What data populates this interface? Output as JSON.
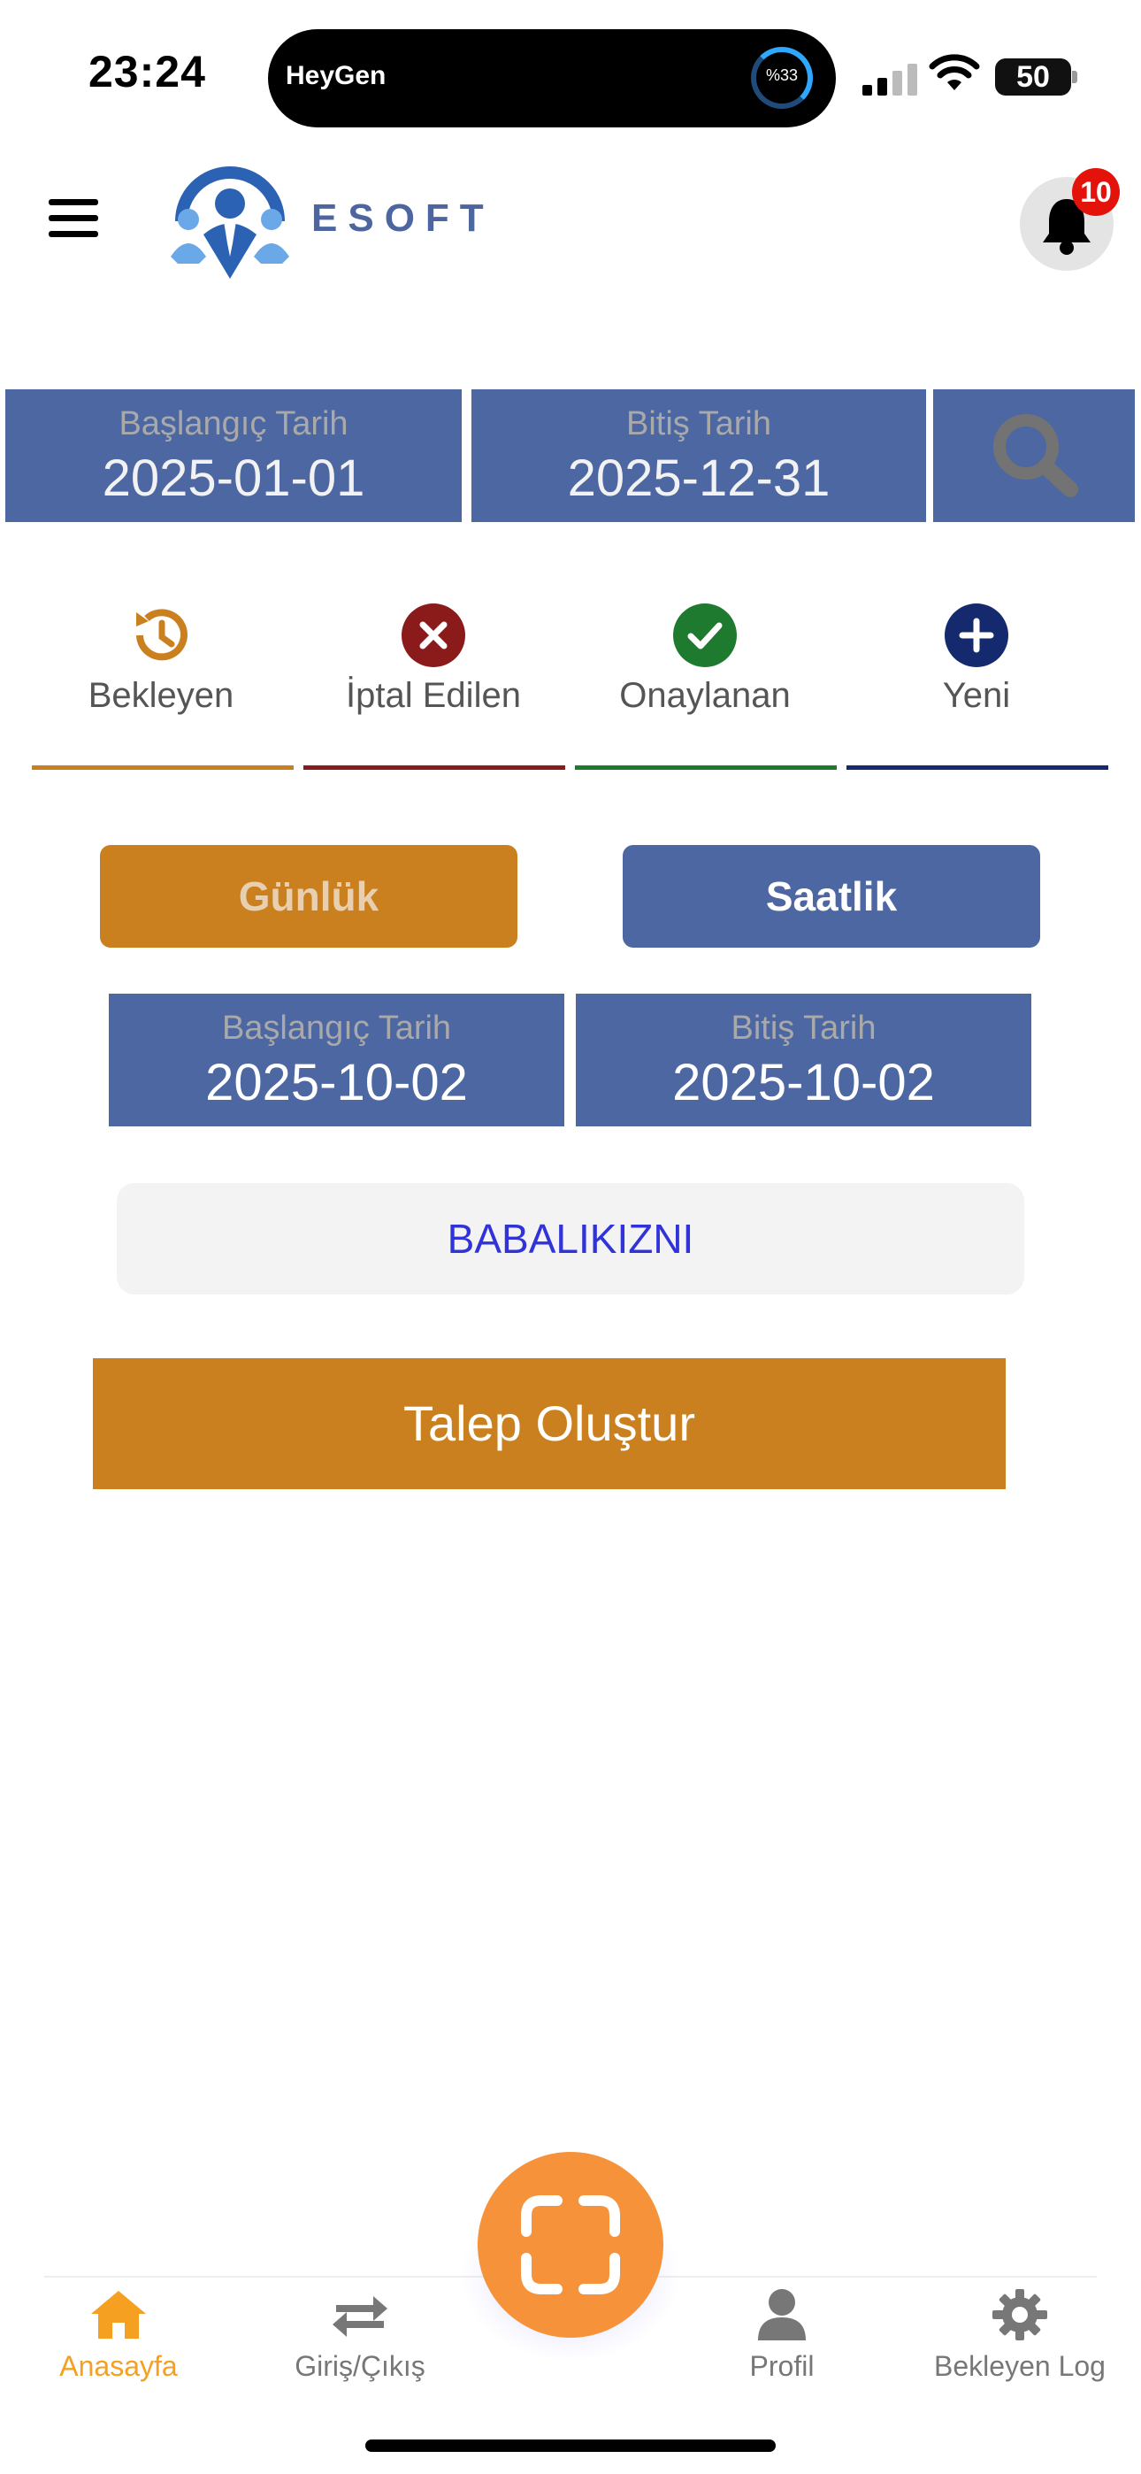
{
  "status_bar": {
    "time": "23:24",
    "island_app": "HeyGen",
    "island_progress": "%33",
    "battery": "50"
  },
  "header": {
    "brand": "ESOFT",
    "notification_count": "10"
  },
  "filter": {
    "start_label": "Başlangıç Tarih",
    "start_value": "2025-01-01",
    "end_label": "Bitiş Tarih",
    "end_value": "2025-12-31",
    "search_icon": "search-icon"
  },
  "tabs": [
    {
      "label": "Bekleyen",
      "icon": "history-icon",
      "color": "#cb801f"
    },
    {
      "label": "İptal Edilen",
      "icon": "cancel-icon",
      "color": "#8b1a1a"
    },
    {
      "label": "Onaylanan",
      "icon": "check-icon",
      "color": "#1e7a2e"
    },
    {
      "label": "Yeni",
      "icon": "plus-icon",
      "color": "#152a6e"
    }
  ],
  "form": {
    "daily_label": "Günlük",
    "hourly_label": "Saatlik",
    "start_label": "Başlangıç Tarih",
    "start_value": "2025-10-02",
    "end_label": "Bitiş Tarih",
    "end_value": "2025-10-02",
    "leave_type": "BABALIKIZNI",
    "submit_label": "Talep Oluştur"
  },
  "bottom_nav": {
    "items": [
      {
        "label": "Anasayfa",
        "icon": "home-icon",
        "active": true
      },
      {
        "label": "Giriş/Çıkış",
        "icon": "swap-arrows-icon",
        "active": false
      },
      {
        "label": "Profil",
        "icon": "user-icon",
        "active": false
      },
      {
        "label": "Bekleyen Log",
        "icon": "gear-icon",
        "active": false
      }
    ],
    "scan_icon": "scan-frame-icon"
  },
  "colors": {
    "primary_blue": "#4d67a2",
    "accent_orange": "#cb801f",
    "scan_orange": "#f5923a",
    "active_nav": "#f5a020"
  }
}
